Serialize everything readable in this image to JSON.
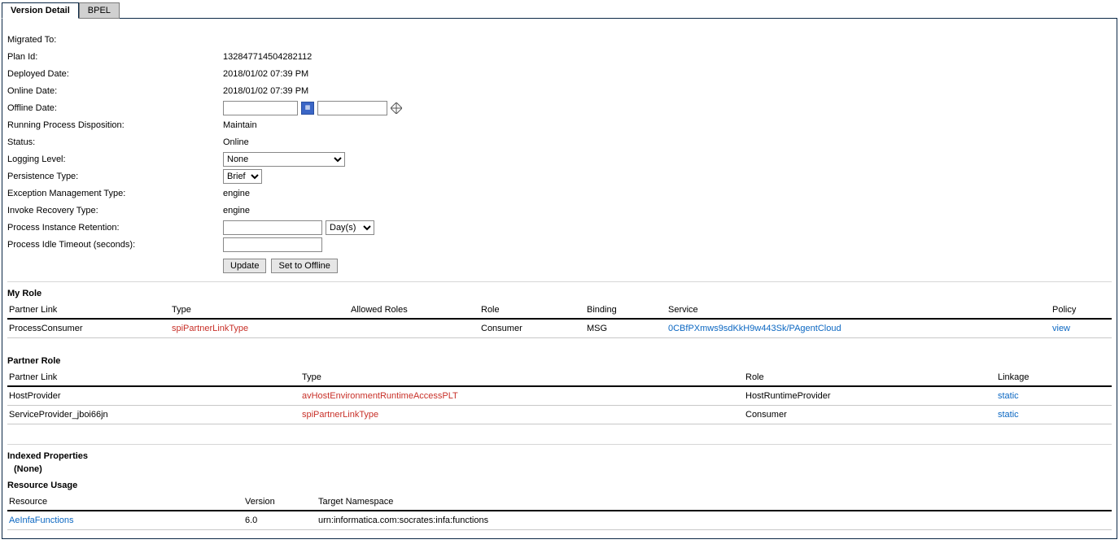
{
  "tabs": {
    "version_detail": "Version Detail",
    "bpel": "BPEL"
  },
  "fields": {
    "migrated_to": {
      "label": "Migrated To:",
      "value": ""
    },
    "plan_id": {
      "label": "Plan Id:",
      "value": "132847714504282112"
    },
    "deployed_date": {
      "label": "Deployed Date:",
      "value": "2018/01/02 07:39 PM"
    },
    "online_date": {
      "label": "Online Date:",
      "value": "2018/01/02 07:39 PM"
    },
    "offline_date": {
      "label": "Offline Date:",
      "date": "",
      "time": ""
    },
    "running_disposition": {
      "label": "Running Process Disposition:",
      "value": "Maintain"
    },
    "status": {
      "label": "Status:",
      "value": "Online"
    },
    "logging_level": {
      "label": "Logging Level:",
      "selected": "None"
    },
    "persistence_type": {
      "label": "Persistence Type:",
      "selected": "Brief"
    },
    "exception_mgmt": {
      "label": "Exception Management Type:",
      "value": "engine"
    },
    "invoke_recovery": {
      "label": "Invoke Recovery Type:",
      "value": "engine"
    },
    "retention": {
      "label": "Process Instance Retention:",
      "value": "",
      "unit": "Day(s)"
    },
    "idle_timeout": {
      "label": "Process Idle Timeout (seconds):",
      "value": ""
    }
  },
  "buttons": {
    "update": "Update",
    "set_offline": "Set to Offline"
  },
  "myrole": {
    "title": "My Role",
    "cols": {
      "partner_link": "Partner Link",
      "type": "Type",
      "allowed_roles": "Allowed Roles",
      "role": "Role",
      "binding": "Binding",
      "service": "Service",
      "policy": "Policy"
    },
    "rows": [
      {
        "partner_link": "ProcessConsumer",
        "type": "spiPartnerLinkType",
        "allowed_roles": "",
        "role": "Consumer",
        "binding": "MSG",
        "service": "0CBfPXmws9sdKkH9w443Sk/PAgentCloud",
        "policy": "view"
      }
    ]
  },
  "partnerrole": {
    "title": "Partner Role",
    "cols": {
      "partner_link": "Partner Link",
      "type": "Type",
      "role": "Role",
      "linkage": "Linkage"
    },
    "rows": [
      {
        "partner_link": "HostProvider",
        "type": "avHostEnvironmentRuntimeAccessPLT",
        "role": "HostRuntimeProvider",
        "linkage": "static"
      },
      {
        "partner_link": "ServiceProvider_jboi66jn",
        "type": "spiPartnerLinkType",
        "role": "Consumer",
        "linkage": "static"
      }
    ]
  },
  "indexed": {
    "title": "Indexed Properties",
    "none": "(None)"
  },
  "resource": {
    "title": "Resource Usage",
    "cols": {
      "resource": "Resource",
      "version": "Version",
      "target_ns": "Target Namespace"
    },
    "rows": [
      {
        "resource": "AeInfaFunctions",
        "version": "6.0",
        "target_ns": "urn:informatica.com:socrates:infa:functions"
      }
    ]
  }
}
